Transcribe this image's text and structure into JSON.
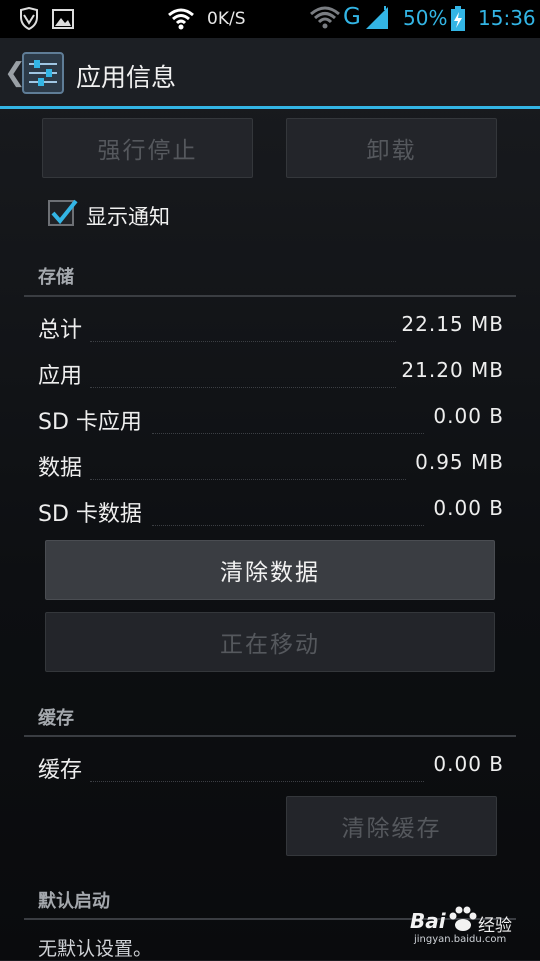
{
  "status_bar": {
    "speed": "0K/S",
    "network": "G",
    "battery_pct": "50%",
    "time": "15:36",
    "icons": [
      "vpn-shield-icon",
      "image-notification-icon",
      "wifi-icon",
      "signal-icon",
      "battery-charging-icon"
    ]
  },
  "action_bar": {
    "title": "应用信息",
    "icon": "settings-sliders-icon"
  },
  "top_buttons": {
    "force_stop": "强行停止",
    "uninstall": "卸载"
  },
  "notification": {
    "label": "显示通知",
    "checked": true
  },
  "storage": {
    "header": "存储",
    "rows": [
      {
        "label": "总计",
        "value": "22.15 MB"
      },
      {
        "label": "应用",
        "value": "21.20 MB"
      },
      {
        "label": "SD 卡应用",
        "value": "0.00 B"
      },
      {
        "label": "数据",
        "value": "0.95 MB"
      },
      {
        "label": "SD 卡数据",
        "value": "0.00 B"
      }
    ],
    "clear_data": "清除数据",
    "moving": "正在移动"
  },
  "cache": {
    "header": "缓存",
    "label": "缓存",
    "value": "0.00 B",
    "clear_cache": "清除缓存"
  },
  "default_launch": {
    "header": "默认启动",
    "text": "无默认设置。"
  },
  "watermark": {
    "brand": "Bai",
    "brand2": "经验",
    "url": "jingyan.baidu.com"
  },
  "colors": {
    "accent": "#33b5e5",
    "background": "#121417"
  }
}
